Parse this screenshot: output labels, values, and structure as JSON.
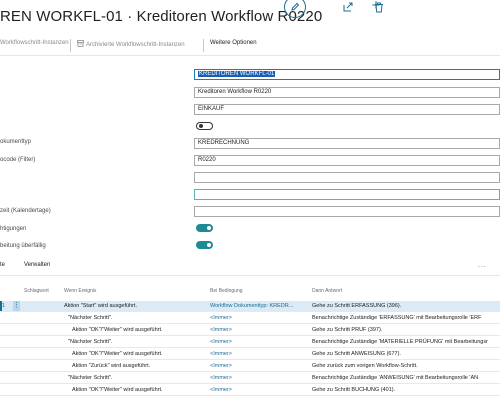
{
  "header": {
    "title": "REN WORKFL-01 · Kreditoren Workflow R0220"
  },
  "actions": {
    "instances": "Workflowschritt-Instanzen",
    "archived": "Archivierte Workflowschritt-Instanzen",
    "more": "Weitere Optionen"
  },
  "fields": [
    {
      "label": "",
      "value": "KREDITOREN WORKFL-01"
    },
    {
      "label": "",
      "value": "Kreditoren Workflow R0220"
    },
    {
      "label": "",
      "value": "EINKAUF"
    },
    {
      "label": "",
      "value": ""
    },
    {
      "label": "okumenttyp",
      "value": "KREDRECHNUNG"
    },
    {
      "label": "ocode (Filter)",
      "value": "R0220"
    },
    {
      "label": "",
      "value": ""
    },
    {
      "label": "",
      "value": ""
    },
    {
      "label": "zeit (Kalendertage)",
      "value": ""
    },
    {
      "label": "htigungen",
      "value": ""
    },
    {
      "label": "beitung überfällig",
      "value": ""
    }
  ],
  "subpage": {
    "tab_partial": "te",
    "tab_manage": "Verwalten",
    "more": "..."
  },
  "table": {
    "columns": [
      "Schlagwort",
      "Wenn Ereignis",
      "Bei Bedingung",
      "Dann Antwort"
    ],
    "rows": [
      {
        "num": "1",
        "event": "Aktion \"Start\" wird ausgeführt.",
        "condition": "Workflow Dokumenttyp: KREDR...",
        "response": "Gehe zu Schritt ERFASSUNG (396)."
      },
      {
        "num": "",
        "event": "\"Nächster Schritt\".",
        "condition": "<Immer>",
        "response": "Benachrichtige Zuständige 'ERFASSUNG' mit Bearbeitungsrolle 'ERF"
      },
      {
        "num": "",
        "event": "Aktion \"OK\"/\"Weiter\" wird ausgeführt.",
        "condition": "<Immer>",
        "response": "Gehe zu Schritt PRUF (397)."
      },
      {
        "num": "",
        "event": "\"Nächster Schritt\".",
        "condition": "<Immer>",
        "response": "Benachrichtige Zuständige 'MATERIELLE PRÜFUNG' mit Bearbeitungsr"
      },
      {
        "num": "",
        "event": "Aktion \"OK\"/\"Weiter\" wird ausgeführt.",
        "condition": "<Immer>",
        "response": "Gehe zu Schritt ANWEISUNG (677)."
      },
      {
        "num": "",
        "event": "Aktion \"Zurück\" wird ausgeführt.",
        "condition": "<Immer>",
        "response": "Gehe zurück zum vorigen Workflow-Schritt."
      },
      {
        "num": "",
        "event": "\"Nächster Schritt\".",
        "condition": "<Immer>",
        "response": "Benachrichtige Zuständige 'ANWEISUNG' mit Bearbeitungsrolle 'AN"
      },
      {
        "num": "",
        "event": "Aktion \"OK\"/\"Weiter\" wird ausgeführt.",
        "condition": "<Immer>",
        "response": "Gehe zu Schritt BUCHUNG (401)."
      }
    ]
  }
}
